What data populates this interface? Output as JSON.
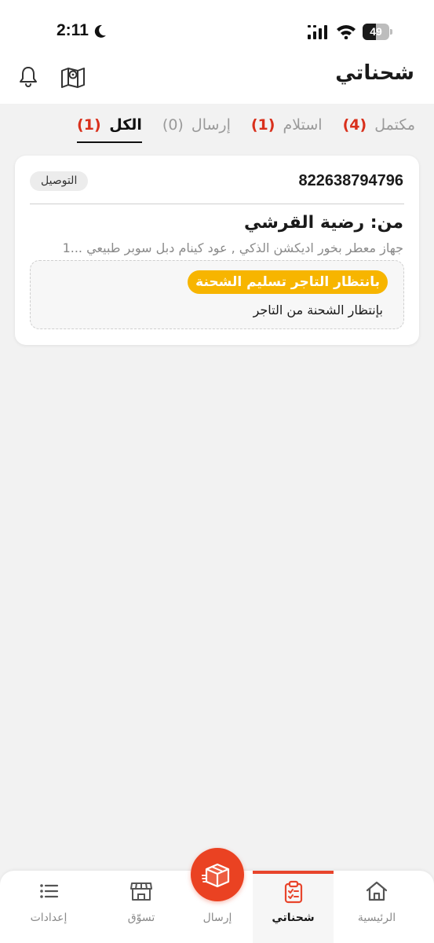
{
  "status_bar": {
    "time": "2:11",
    "battery": "49",
    "battery_level": 0.49
  },
  "header": {
    "title": "شحناتي"
  },
  "tabs": [
    {
      "label": "الكل",
      "count": "(1)"
    },
    {
      "label": "إرسال",
      "count": "(0)"
    },
    {
      "label": "استلام",
      "count": "(1)"
    },
    {
      "label": "مكتمل",
      "count": "(4)"
    }
  ],
  "shipment": {
    "tracking_number": "822638794796",
    "type_badge": "التوصيل",
    "sender": "من: رضية القرشي",
    "items": "جهاز معطر بخور  اديكشن الذكي , عود كينام دبل سوبر طبيعي ...1",
    "status_label": "بانتظار التاجر تسليم الشحنة",
    "status_description": "بإنتظار الشحنة من التاجر"
  },
  "bottom_nav": {
    "home": "الرئيسية",
    "shipments": "شحناتي",
    "send": "إرسال",
    "shop": "تسوّق",
    "settings": "إعدادات"
  },
  "colors": {
    "accent": "#ea4222",
    "count_red": "#d9301c",
    "status_yellow": "#f7b500"
  }
}
